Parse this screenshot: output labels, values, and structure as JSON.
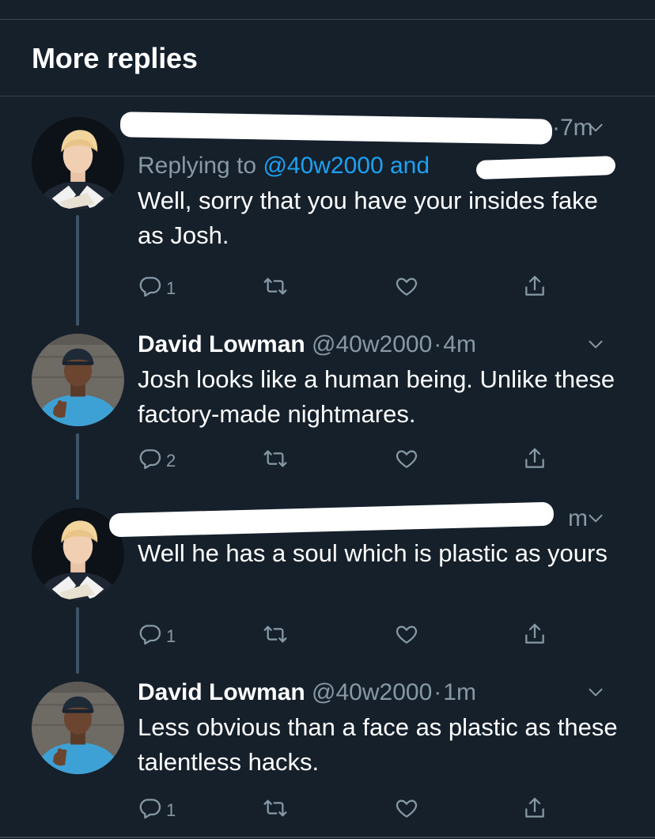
{
  "header": {
    "title": "More replies"
  },
  "tweets": [
    {
      "avatar": "avatar-blond-person",
      "name": "",
      "handle": "",
      "sep": "·",
      "time": "7m",
      "replying_prefix": "Replying to ",
      "replying_link": "@40w2000 and",
      "text": "Well, sorry that you have your insides fake as Josh.",
      "counts": {
        "reply": "1",
        "retweet": "",
        "like": ""
      }
    },
    {
      "avatar": "avatar-man-thumbs-up",
      "name": "David Lowman",
      "handle": "@40w2000",
      "sep": "·",
      "time": "4m",
      "text": "Josh looks like a human being. Unlike these factory-made nightmares.",
      "counts": {
        "reply": "2",
        "retweet": "",
        "like": ""
      }
    },
    {
      "avatar": "avatar-blond-person",
      "name": "",
      "handle": "",
      "sep": "",
      "time": "m",
      "text": "Well he has a soul which is plastic as yours",
      "counts": {
        "reply": "1",
        "retweet": "",
        "like": ""
      }
    },
    {
      "avatar": "avatar-man-thumbs-up",
      "name": "David Lowman",
      "handle": "@40w2000",
      "sep": "·",
      "time": "1m",
      "text": "Less obvious than a face as plastic as these talentless hacks.",
      "counts": {
        "reply": "1",
        "retweet": "",
        "like": ""
      }
    }
  ],
  "colors": {
    "background": "#15202b",
    "divider": "#38444d",
    "secondary_text": "#8899a6",
    "link": "#1da1f2",
    "thread_line": "#3d5466"
  },
  "icons": [
    "reply-icon",
    "retweet-icon",
    "like-icon",
    "share-icon",
    "chevron-down-icon"
  ]
}
